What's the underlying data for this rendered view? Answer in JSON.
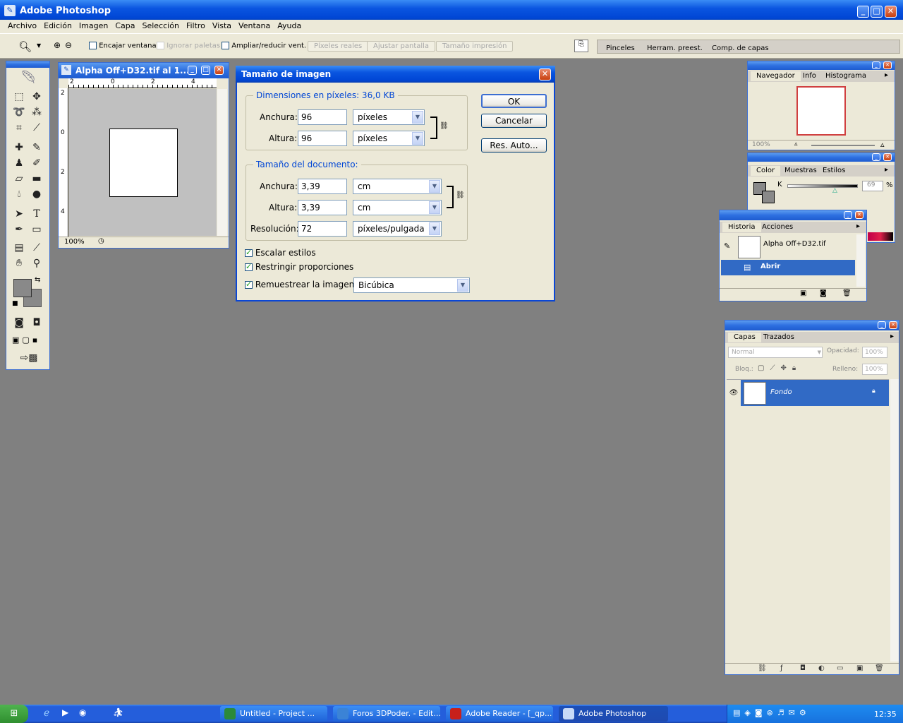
{
  "app": {
    "title": "Adobe Photoshop"
  },
  "menu": [
    "Archivo",
    "Edición",
    "Imagen",
    "Capa",
    "Selección",
    "Filtro",
    "Vista",
    "Ventana",
    "Ayuda"
  ],
  "options_bar": {
    "fit_window": "Encajar ventana",
    "ignore_palettes": "Ignorar paletas",
    "resize_windows": "Ampliar/reducir vent.",
    "actual_pixels": "Píxeles reales",
    "fit_screen": "Ajustar pantalla",
    "print_size": "Tamaño impresión",
    "wells": [
      "Pinceles",
      "Herram. preest.",
      "Comp. de capas"
    ]
  },
  "document": {
    "title": "Alpha Off+D32.tif al 1...",
    "zoom": "100%",
    "ruler_marks": [
      "2",
      "0",
      "2",
      "4"
    ],
    "vruler_marks": [
      "2",
      "0",
      "2",
      "4"
    ]
  },
  "dialog": {
    "title": "Tamaño de imagen",
    "pixel_dims": {
      "legend": "Dimensiones en píxeles: 36,0 KB",
      "width_label": "Anchura:",
      "width": "96",
      "width_unit": "píxeles",
      "height_label": "Altura:",
      "height": "96",
      "height_unit": "píxeles"
    },
    "doc_size": {
      "legend": "Tamaño del documento:",
      "width_label": "Anchura:",
      "width": "3,39",
      "width_unit": "cm",
      "height_label": "Altura:",
      "height": "3,39",
      "height_unit": "cm",
      "res_label": "Resolución:",
      "res": "72",
      "res_unit": "píxeles/pulgada"
    },
    "scale_styles": "Escalar estilos",
    "constrain": "Restringir proporciones",
    "resample": "Remuestrear la imagen:",
    "resample_method": "Bicúbica",
    "ok": "OK",
    "cancel": "Cancelar",
    "auto": "Res. Auto..."
  },
  "navigator": {
    "tabs": [
      "Navegador",
      "Info",
      "Histograma"
    ],
    "zoom": "100%"
  },
  "color": {
    "tabs": [
      "Color",
      "Muestras",
      "Estilos"
    ],
    "channel": "K",
    "value": "69",
    "unit": "%"
  },
  "history": {
    "tabs": [
      "Historia",
      "Acciones"
    ],
    "snapshot": "Alpha Off+D32.tif",
    "step": "Abrir"
  },
  "layers": {
    "tabs": [
      "Capas",
      "Trazados"
    ],
    "blend": "Normal",
    "opacity_label": "Opacidad:",
    "opacity": "100%",
    "lock_label": "Bloq.:",
    "fill_label": "Relleno:",
    "fill": "100%",
    "layer_name": "Fondo"
  },
  "taskbar": {
    "items": [
      "Untitled    - Project ...",
      "Foros 3DPoder. - Edit...",
      "Adobe Reader - [_qp...",
      "Adobe Photoshop"
    ],
    "clock": "12:35"
  },
  "colors": {
    "accent": "#316ac5",
    "titlebar": "#0a55e0",
    "workspace": "#808080"
  }
}
